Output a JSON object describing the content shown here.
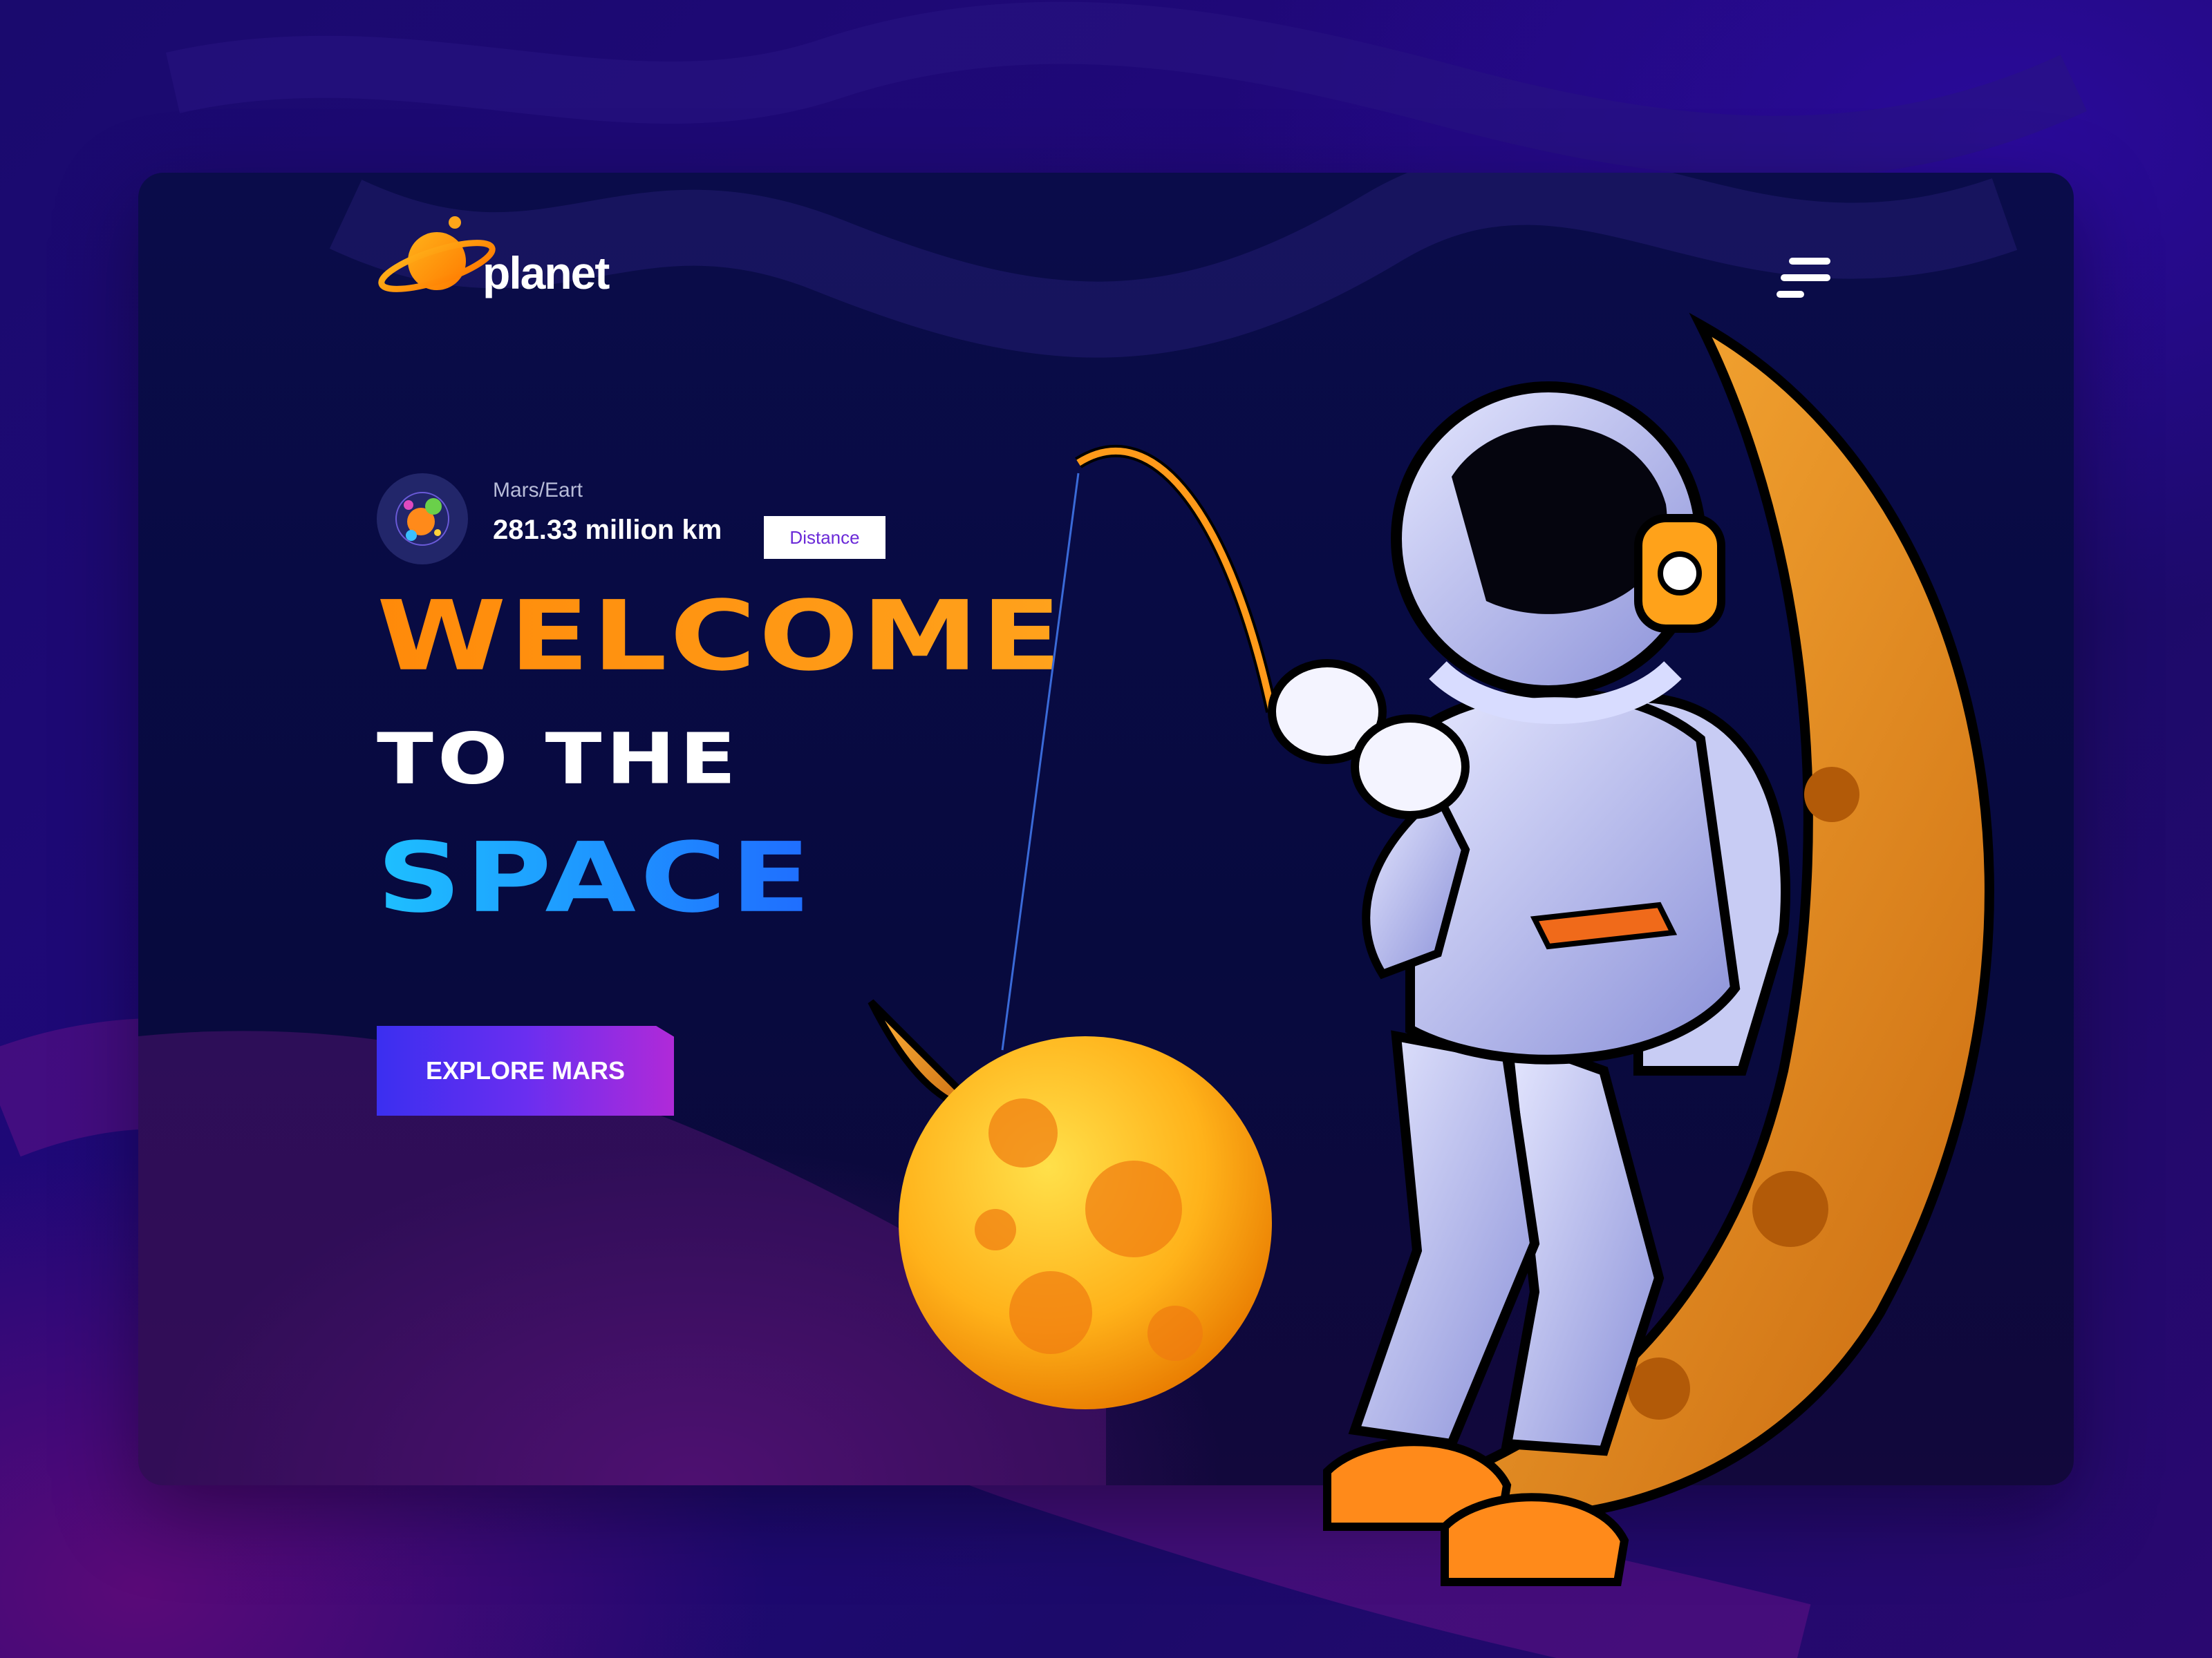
{
  "brand": {
    "name": "planet"
  },
  "distance": {
    "label": "Mars/Eart",
    "value": "281.33 million km",
    "badge": "Distance"
  },
  "hero": {
    "line1": "WELCOME",
    "line2": "TO THE",
    "line3": "SPACE"
  },
  "cta": {
    "label": "EXPLORE MARS"
  },
  "icons": {
    "logo": "planet-logo-icon",
    "menu": "menu-icon",
    "distance": "planets-icon"
  },
  "colors": {
    "accent_orange": "#ff8a0a",
    "accent_blue": "#1f8cff",
    "button_start": "#3b2ff0",
    "button_end": "#b02ad8",
    "card_bg": "#0a0c4a"
  }
}
